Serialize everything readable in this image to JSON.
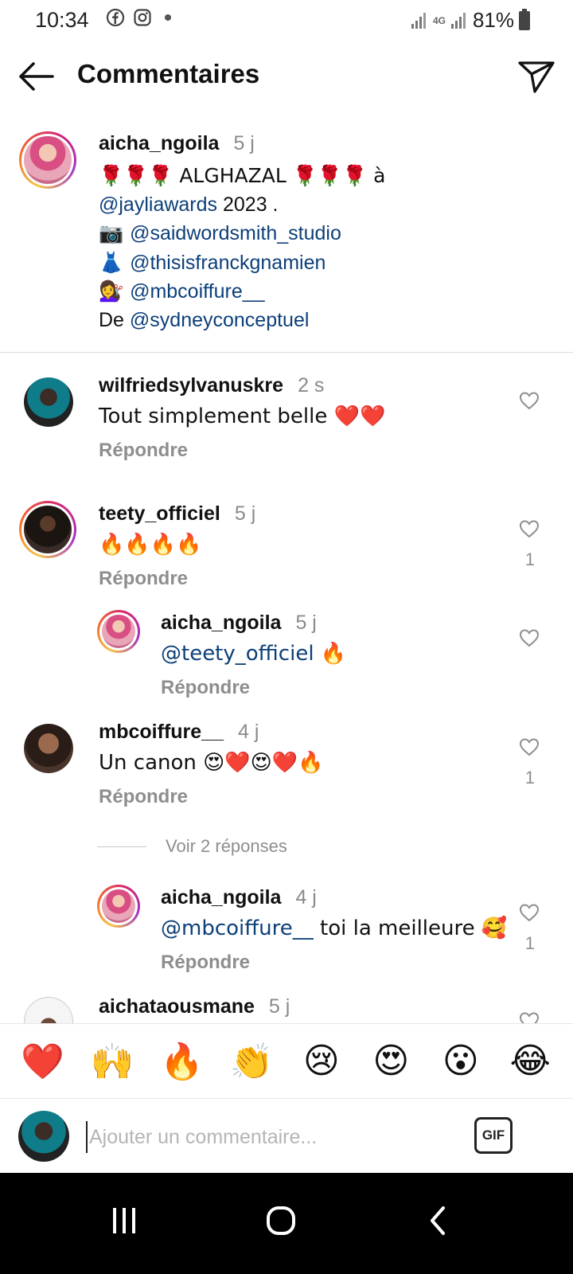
{
  "status_bar": {
    "time": "10:34",
    "network": "4G",
    "battery": "81%",
    "icons": [
      "facebook-icon",
      "instagram-icon",
      "notification-dot-icon",
      "signal-icon",
      "battery-icon"
    ]
  },
  "header": {
    "title": "Commentaires",
    "back_icon": "arrow-left-icon",
    "share_icon": "send-icon"
  },
  "caption": {
    "username": "aicha_ngoila",
    "time": "5 j",
    "lines": [
      {
        "prefix": "🌹🌹🌹 ALGHAZAL 🌹🌹🌹 à",
        "mention": "",
        "suffix": ""
      },
      {
        "prefix": "",
        "mention": "@jayliawards",
        "suffix": " 2023 ."
      },
      {
        "prefix": "📷 ",
        "mention": "@saidwordsmith_studio",
        "suffix": ""
      },
      {
        "prefix": "👗 ",
        "mention": "@thisisfranckgnamien",
        "suffix": ""
      },
      {
        "prefix": "💇‍♀️ ",
        "mention": "@mbcoiffure__",
        "suffix": ""
      },
      {
        "prefix": "De ",
        "mention": "@sydneyconceptuel",
        "suffix": ""
      }
    ]
  },
  "comments": [
    {
      "username": "wilfriedsylvanuskre",
      "time": "2 s",
      "mention": "",
      "text": "Tout simplement belle ❤️❤️",
      "reply_label": "Répondre",
      "likes": ""
    },
    {
      "username": "teety_officiel",
      "time": "5 j",
      "mention": "",
      "text": "🔥🔥🔥🔥",
      "reply_label": "Répondre",
      "likes": "1"
    },
    {
      "username": "aicha_ngoila",
      "time": "5 j",
      "mention": "@teety_officiel",
      "text": " 🔥",
      "reply_label": "Répondre",
      "likes": ""
    },
    {
      "username": "mbcoiffure__",
      "time": "4 j",
      "mention": "",
      "text": "Un canon 😍❤️😍❤️🔥",
      "reply_label": "Répondre",
      "likes": "1"
    },
    {
      "username": "aicha_ngoila",
      "time": "4 j",
      "mention": "@mbcoiffure__",
      "text": " toi la meilleure 🥰",
      "reply_label": "Répondre",
      "likes": "1"
    },
    {
      "username": "aichataousmane",
      "time": "5 j",
      "mention": "",
      "text": "",
      "reply_label": "",
      "likes": ""
    }
  ],
  "view_replies": "Voir 2 réponses",
  "reactions": [
    "❤️",
    "🙌",
    "🔥",
    "👏",
    "😢",
    "😍",
    "😮",
    "😂"
  ],
  "composer": {
    "placeholder": "Ajouter un commentaire...",
    "gif_label": "GIF"
  },
  "nav_bar": {
    "icons": [
      "recent-apps-icon",
      "home-icon",
      "back-icon"
    ]
  },
  "colors": {
    "mention": "#0c3f7a",
    "muted": "#8e8e8e",
    "story_ring": [
      "#f7c34a",
      "#f26a2e",
      "#d6246e",
      "#a334c5"
    ]
  }
}
